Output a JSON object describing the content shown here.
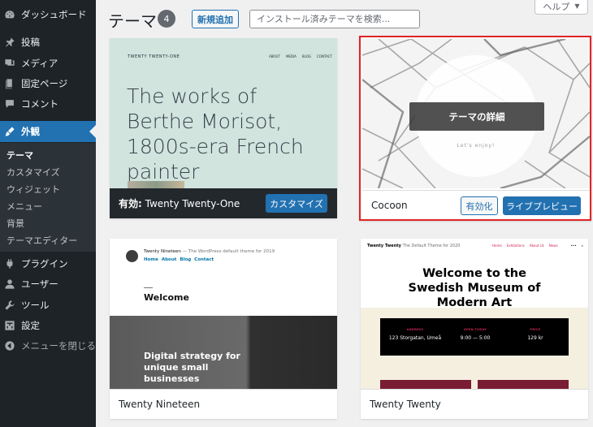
{
  "sidebar": {
    "items": [
      {
        "id": "dashboard",
        "label": "ダッシュボード",
        "icon": "dashboard-icon"
      },
      {
        "id": "posts",
        "label": "投稿",
        "icon": "pin-icon"
      },
      {
        "id": "media",
        "label": "メディア",
        "icon": "media-icon"
      },
      {
        "id": "pages",
        "label": "固定ページ",
        "icon": "page-icon"
      },
      {
        "id": "comments",
        "label": "コメント",
        "icon": "comment-icon"
      },
      {
        "id": "appearance",
        "label": "外観",
        "icon": "brush-icon",
        "current": true
      },
      {
        "id": "plugins",
        "label": "プラグイン",
        "icon": "plugin-icon"
      },
      {
        "id": "users",
        "label": "ユーザー",
        "icon": "user-icon"
      },
      {
        "id": "tools",
        "label": "ツール",
        "icon": "wrench-icon"
      },
      {
        "id": "settings",
        "label": "設定",
        "icon": "settings-icon"
      },
      {
        "id": "collapse",
        "label": "メニューを閉じる",
        "icon": "collapse-icon"
      }
    ],
    "submenu": [
      {
        "label": "テーマ",
        "active": true
      },
      {
        "label": "カスタマイズ"
      },
      {
        "label": "ウィジェット"
      },
      {
        "label": "メニュー"
      },
      {
        "label": "背景"
      },
      {
        "label": "テーマエディター"
      }
    ]
  },
  "header": {
    "title": "テーマ",
    "count": "4",
    "add_new": "新規追加",
    "search_placeholder": "インストール済みテーマを検索...",
    "help": "ヘルプ"
  },
  "themes": {
    "tt1": {
      "active_prefix": "有効:",
      "name": "Twenty Twenty-One",
      "customize": "カスタマイズ",
      "preview": {
        "site": "TWENTY TWENTY-ONE",
        "nav": [
          "ABOUT",
          "MEDIA",
          "BLOG",
          "CONTACT"
        ],
        "hero": "The works of Berthe Morisot, 1800s-era French painter"
      }
    },
    "cocoon": {
      "name": "Cocoon",
      "details": "テーマの詳細",
      "activate": "有効化",
      "live_preview": "ライブプレビュー",
      "preview": {
        "tagline": "Let's enjoy!"
      }
    },
    "tt19": {
      "name": "Twenty Nineteen",
      "preview": {
        "site": "Twenty Nineteen",
        "tagline": "— The WordPress default theme for 2019",
        "nav": [
          "Home",
          "About",
          "Blog",
          "Contact"
        ],
        "welcome": "Welcome",
        "strap": "Digital strategy for unique small businesses"
      }
    },
    "tt20": {
      "name": "Twenty Twenty",
      "preview": {
        "site": "Twenty Twenty",
        "tagline": "The Default Theme for 2020",
        "nav": [
          "Home",
          "Exhibitions",
          "About Us",
          "News"
        ],
        "hero": "Welcome to the Swedish Museum of Modern Art",
        "table": [
          {
            "key": "ADDRESS",
            "value": "123 Storgatan, Umeå"
          },
          {
            "key": "OPEN TODAY",
            "value": "9:00 — 5:00"
          },
          {
            "key": "PRICE",
            "value": "129 kr"
          }
        ]
      }
    }
  },
  "colors": {
    "sidebar_bg": "#1d2327",
    "accent": "#2271b1",
    "highlight_border": "#e02424"
  }
}
